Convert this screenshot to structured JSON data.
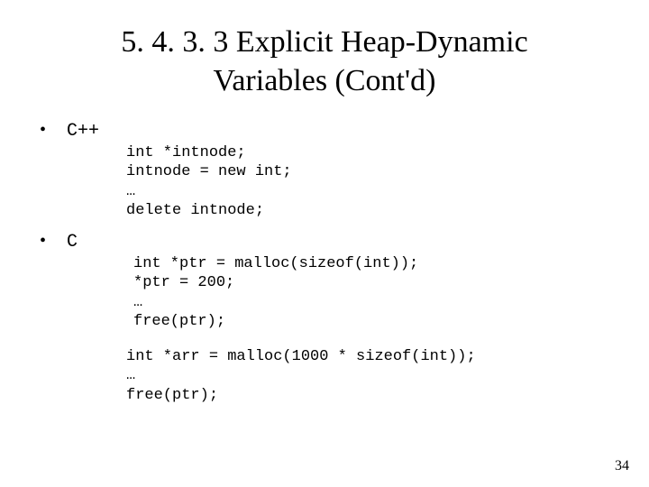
{
  "title_line1": "5. 4. 3. 3 Explicit Heap-Dynamic",
  "title_line2": "Variables (Cont'd)",
  "bullets": {
    "cpp": {
      "marker": "•",
      "label": "C++"
    },
    "c": {
      "marker": "•",
      "label": "C"
    }
  },
  "code": {
    "cpp": "int *intnode;\nintnode = new int;\n…\ndelete intnode;",
    "c1": "int *ptr = malloc(sizeof(int));\n*ptr = 200;\n…\nfree(ptr);",
    "c2": "int *arr = malloc(1000 * sizeof(int));\n…\nfree(ptr);"
  },
  "page_number": "34"
}
